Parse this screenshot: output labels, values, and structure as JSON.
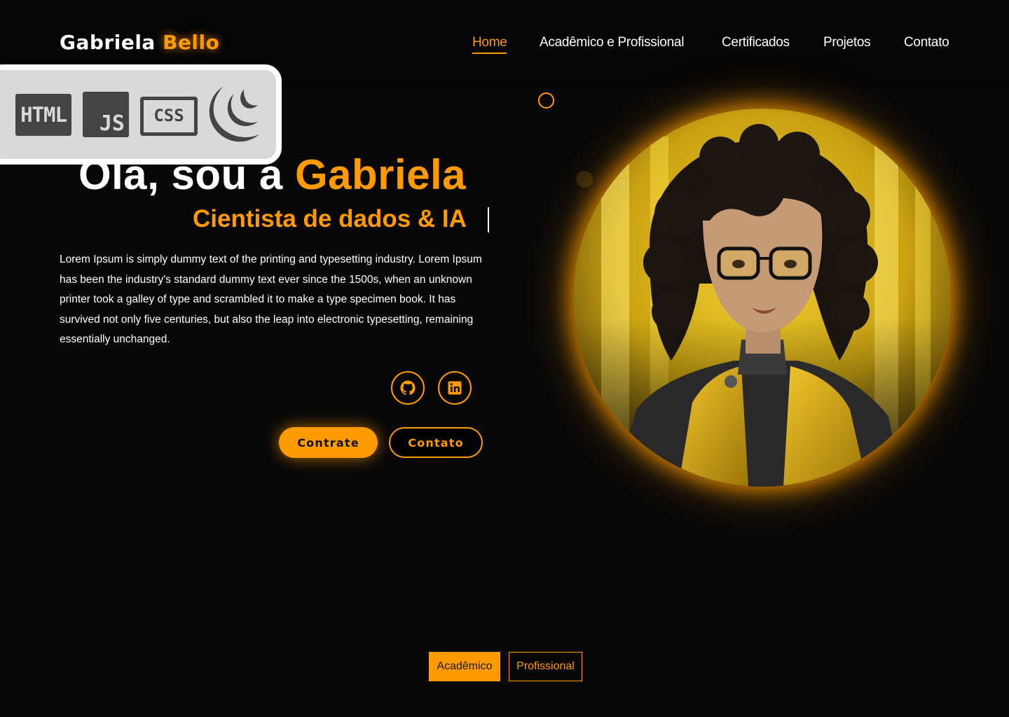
{
  "header": {
    "logo_first": "Gabriela",
    "logo_last": "Bello",
    "nav": [
      {
        "label": "Home",
        "active": true
      },
      {
        "label": "Acadêmico e Profissional",
        "active": false
      },
      {
        "label": "Certificados",
        "active": false
      },
      {
        "label": "Projetos",
        "active": false
      },
      {
        "label": "Contato",
        "active": false
      }
    ]
  },
  "tech_badges": [
    {
      "name": "html-icon",
      "label": "HTML"
    },
    {
      "name": "js-icon",
      "label": "JS"
    },
    {
      "name": "css-icon",
      "label": "CSS"
    },
    {
      "name": "jquery-icon",
      "label": ""
    }
  ],
  "hero": {
    "greeting": "Olá, sou a ",
    "name": "Gabriela",
    "subtitle": "Cientista de dados & IA",
    "description": "Lorem Ipsum is simply dummy text of the printing and typesetting industry. Lorem Ipsum has been the industry's standard dummy text ever since the 1500s, when an unknown printer took a galley of type and scrambled it to make a type specimen book. It has survived not only five centuries, but also the leap into electronic typesetting, remaining essentially unchanged."
  },
  "socials": [
    {
      "name": "github-icon"
    },
    {
      "name": "linkedin-icon"
    }
  ],
  "buttons": {
    "primary": "Contrate",
    "secondary": "Contato"
  },
  "tabs": [
    {
      "label": "Acadêmico",
      "active": true
    },
    {
      "label": "Profissional",
      "active": false
    }
  ],
  "colors": {
    "accent": "#ff9a00",
    "background": "#080808",
    "text": "#ffffff"
  }
}
